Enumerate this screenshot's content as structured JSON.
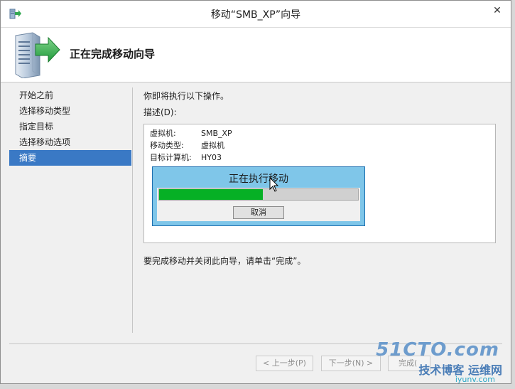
{
  "window": {
    "title": "移动“SMB_XP”向导",
    "close_glyph": "✕"
  },
  "header": {
    "heading": "正在完成移动向导"
  },
  "nav": {
    "items": [
      {
        "label": "开始之前",
        "active": false
      },
      {
        "label": "选择移动类型",
        "active": false
      },
      {
        "label": "指定目标",
        "active": false
      },
      {
        "label": "选择移动选项",
        "active": false
      },
      {
        "label": "摘要",
        "active": true
      }
    ]
  },
  "content": {
    "intro": "你即将执行以下操作。",
    "description_label": "描述(D):",
    "details": [
      {
        "key": "虚拟机:",
        "value": "SMB_XP"
      },
      {
        "key": "移动类型:",
        "value": "虚拟机"
      },
      {
        "key": "目标计算机:",
        "value": "HY03"
      }
    ],
    "finish_note": "要完成移动并关闭此向导，请单击“完成”。"
  },
  "progress_dialog": {
    "title": "正在执行移动",
    "progress": 0.52,
    "cancel_label": "取消"
  },
  "footer": {
    "prev_label": "< 上一步(P)",
    "next_label": "下一步(N) >",
    "finish_label": "完成("
  },
  "watermark": {
    "line1": "51CTO.com",
    "line2": "技术博客 运维网",
    "line3": "iyunv.com"
  },
  "colors": {
    "selection": "#3a79c5",
    "progress_fill": "#06b025",
    "dialog_bg": "#7fc6e9"
  },
  "icons": {
    "app": "wizard-app-icon",
    "hero": "server-migrate-icon",
    "close": "close-icon",
    "cursor": "mouse-pointer-icon"
  }
}
